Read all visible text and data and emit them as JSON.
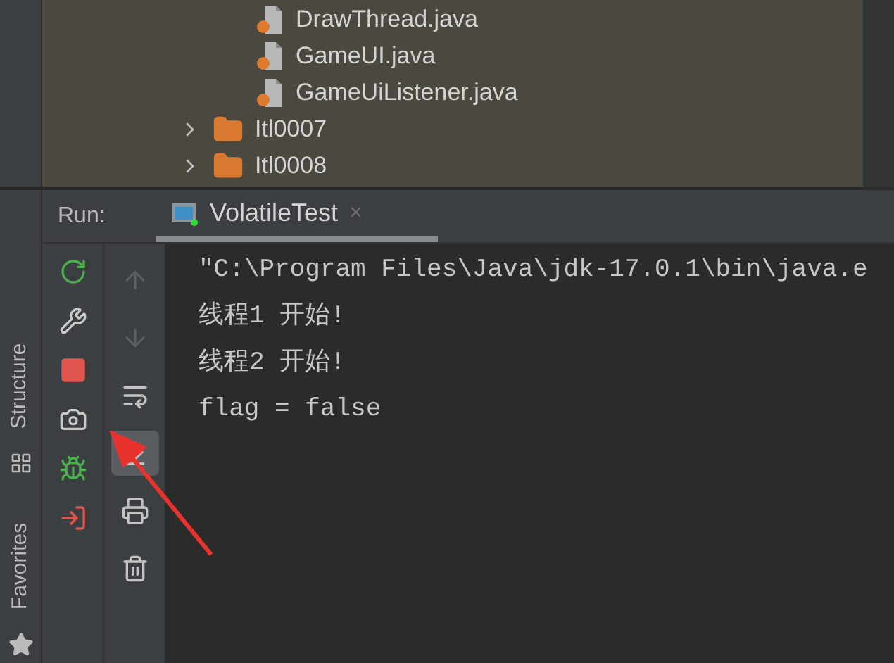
{
  "project_tree": {
    "items": [
      {
        "kind": "file",
        "label": "DrawThread.java"
      },
      {
        "kind": "file",
        "label": "GameUI.java"
      },
      {
        "kind": "file",
        "label": "GameUiListener.java"
      },
      {
        "kind": "folder",
        "label": "Itl0007",
        "expanded": false
      },
      {
        "kind": "folder",
        "label": "Itl0008",
        "expanded": false
      }
    ]
  },
  "side_tabs": [
    "Structure",
    "Favorites"
  ],
  "run_panel": {
    "title": "Run:",
    "tabs": [
      {
        "label": "VolatileTest",
        "close": "×",
        "selected": true
      }
    ],
    "tools": [
      {
        "disabled": false
      },
      {
        "disabled": false
      },
      {
        "disabled": false
      },
      {
        "disabled": false
      },
      {
        "disabled": false
      },
      {
        "disabled": false
      }
    ],
    "tools_secondary": [
      {
        "disabled": true,
        "on": false
      },
      {
        "disabled": true,
        "on": false
      },
      {
        "disabled": false,
        "on": false
      },
      {
        "disabled": false,
        "on": true
      },
      {
        "disabled": false,
        "on": false
      },
      {
        "disabled": false,
        "on": false
      }
    ],
    "console": [
      "\"C:\\Program Files\\Java\\jdk-17.0.1\\bin\\java.e",
      "线程1 开始!",
      "线程2 开始!",
      "flag = false"
    ]
  }
}
